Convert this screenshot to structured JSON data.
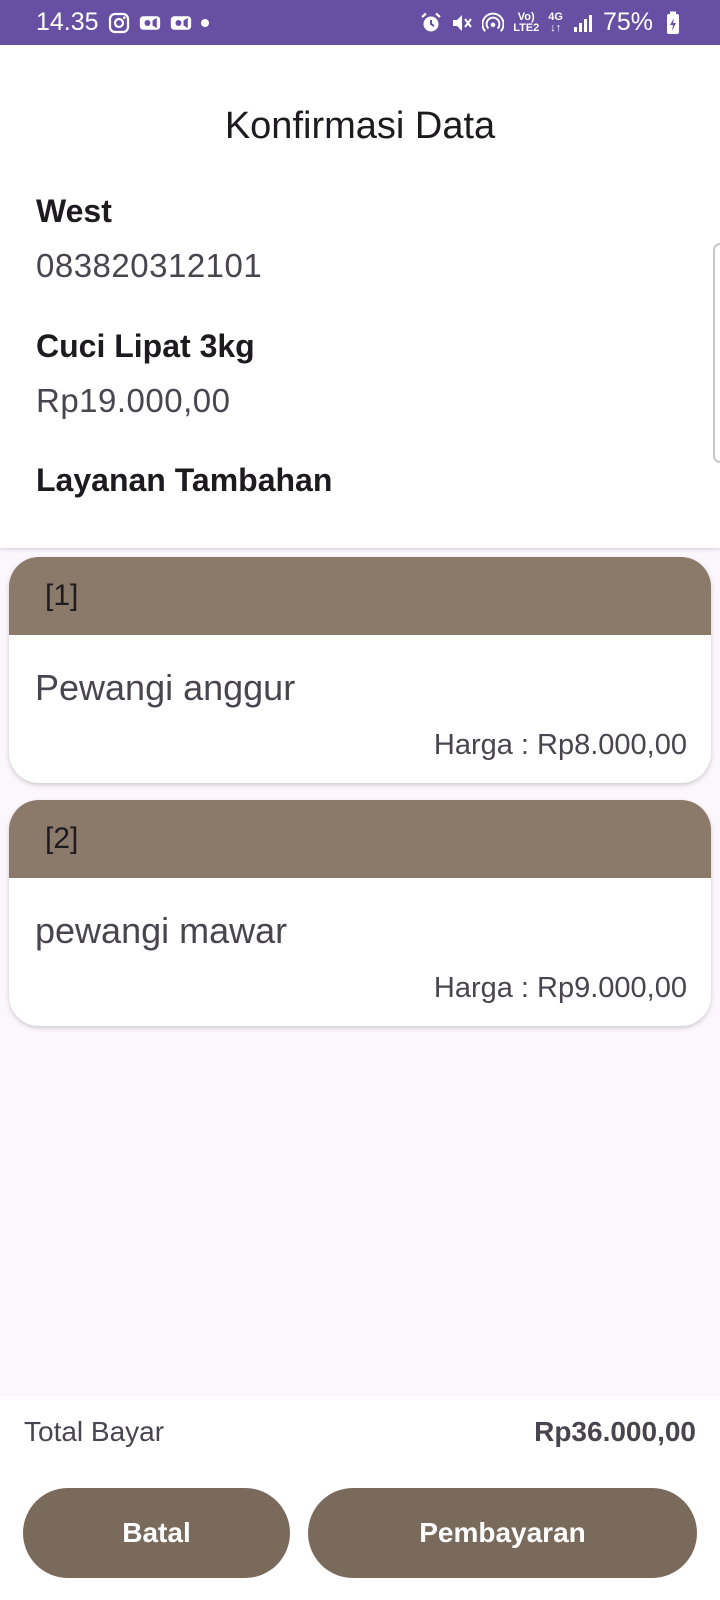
{
  "status_bar": {
    "time": "14.35",
    "battery": "75%",
    "network_top": "Vo)",
    "network_bottom": "LTE2",
    "data_top": "4G",
    "data_bottom": "↓↑",
    "background_color": "#6750a4"
  },
  "page": {
    "title": "Konfirmasi Data"
  },
  "customer": {
    "name": "West",
    "phone": "083820312101"
  },
  "service": {
    "name": "Cuci Lipat 3kg",
    "price": "Rp19.000,00"
  },
  "additional": {
    "heading": "Layanan Tambahan",
    "items": [
      {
        "index": "[1]",
        "name": "Pewangi anggur",
        "price": "Harga : Rp8.000,00"
      },
      {
        "index": "[2]",
        "name": "pewangi mawar",
        "price": "Harga : Rp9.000,00"
      }
    ]
  },
  "footer": {
    "total_label": "Total Bayar",
    "total_value": "Rp36.000,00",
    "cancel_label": "Batal",
    "pay_label": "Pembayaran"
  },
  "colors": {
    "card_header": "#8b7969",
    "button": "#7a6a5c",
    "background": "#fcf6fd"
  }
}
